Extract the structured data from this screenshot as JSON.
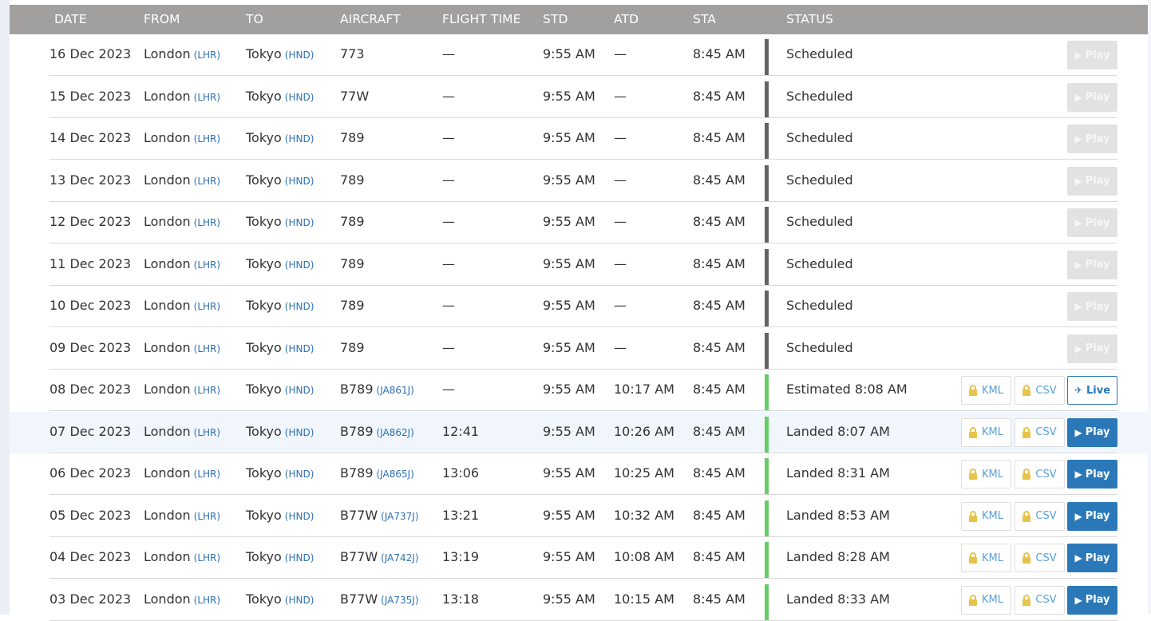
{
  "headers": {
    "date": "DATE",
    "from": "FROM",
    "to": "TO",
    "aircraft": "AIRCRAFT",
    "flight_time": "FLIGHT TIME",
    "std": "STD",
    "atd": "ATD",
    "sta": "STA",
    "status": "STATUS"
  },
  "buttons": {
    "play": "Play",
    "live": "Live",
    "kml": "KML",
    "csv": "CSV"
  },
  "colors": {
    "header_bg": "#a29f9f",
    "accent_blue": "#2b78b9",
    "status_scheduled": "#636363",
    "status_flown": "#66cc66",
    "row_highlight": "#f0f6fc"
  },
  "icons": {
    "play": "play-icon",
    "live": "airplane-icon",
    "locked": "lock-icon"
  },
  "rows": [
    {
      "date": "16 Dec 2023",
      "from": "London",
      "from_code": "(LHR)",
      "to": "Tokyo",
      "to_code": "(HND)",
      "aircraft": "773",
      "reg": "",
      "flight_time": "—",
      "std": "9:55 AM",
      "atd": "—",
      "sta": "8:45 AM",
      "status": "Scheduled",
      "state": "scheduled"
    },
    {
      "date": "15 Dec 2023",
      "from": "London",
      "from_code": "(LHR)",
      "to": "Tokyo",
      "to_code": "(HND)",
      "aircraft": "77W",
      "reg": "",
      "flight_time": "—",
      "std": "9:55 AM",
      "atd": "—",
      "sta": "8:45 AM",
      "status": "Scheduled",
      "state": "scheduled"
    },
    {
      "date": "14 Dec 2023",
      "from": "London",
      "from_code": "(LHR)",
      "to": "Tokyo",
      "to_code": "(HND)",
      "aircraft": "789",
      "reg": "",
      "flight_time": "—",
      "std": "9:55 AM",
      "atd": "—",
      "sta": "8:45 AM",
      "status": "Scheduled",
      "state": "scheduled"
    },
    {
      "date": "13 Dec 2023",
      "from": "London",
      "from_code": "(LHR)",
      "to": "Tokyo",
      "to_code": "(HND)",
      "aircraft": "789",
      "reg": "",
      "flight_time": "—",
      "std": "9:55 AM",
      "atd": "—",
      "sta": "8:45 AM",
      "status": "Scheduled",
      "state": "scheduled"
    },
    {
      "date": "12 Dec 2023",
      "from": "London",
      "from_code": "(LHR)",
      "to": "Tokyo",
      "to_code": "(HND)",
      "aircraft": "789",
      "reg": "",
      "flight_time": "—",
      "std": "9:55 AM",
      "atd": "—",
      "sta": "8:45 AM",
      "status": "Scheduled",
      "state": "scheduled"
    },
    {
      "date": "11 Dec 2023",
      "from": "London",
      "from_code": "(LHR)",
      "to": "Tokyo",
      "to_code": "(HND)",
      "aircraft": "789",
      "reg": "",
      "flight_time": "—",
      "std": "9:55 AM",
      "atd": "—",
      "sta": "8:45 AM",
      "status": "Scheduled",
      "state": "scheduled"
    },
    {
      "date": "10 Dec 2023",
      "from": "London",
      "from_code": "(LHR)",
      "to": "Tokyo",
      "to_code": "(HND)",
      "aircraft": "789",
      "reg": "",
      "flight_time": "—",
      "std": "9:55 AM",
      "atd": "—",
      "sta": "8:45 AM",
      "status": "Scheduled",
      "state": "scheduled"
    },
    {
      "date": "09 Dec 2023",
      "from": "London",
      "from_code": "(LHR)",
      "to": "Tokyo",
      "to_code": "(HND)",
      "aircraft": "789",
      "reg": "",
      "flight_time": "—",
      "std": "9:55 AM",
      "atd": "—",
      "sta": "8:45 AM",
      "status": "Scheduled",
      "state": "scheduled"
    },
    {
      "date": "08 Dec 2023",
      "from": "London",
      "from_code": "(LHR)",
      "to": "Tokyo",
      "to_code": "(HND)",
      "aircraft": "B789",
      "reg": "(JA861J)",
      "flight_time": "—",
      "std": "9:55 AM",
      "atd": "10:17 AM",
      "sta": "8:45 AM",
      "status": "Estimated 8:08 AM",
      "state": "live"
    },
    {
      "date": "07 Dec 2023",
      "from": "London",
      "from_code": "(LHR)",
      "to": "Tokyo",
      "to_code": "(HND)",
      "aircraft": "B789",
      "reg": "(JA862J)",
      "flight_time": "12:41",
      "std": "9:55 AM",
      "atd": "10:26 AM",
      "sta": "8:45 AM",
      "status": "Landed 8:07 AM",
      "state": "landed",
      "highlight": true
    },
    {
      "date": "06 Dec 2023",
      "from": "London",
      "from_code": "(LHR)",
      "to": "Tokyo",
      "to_code": "(HND)",
      "aircraft": "B789",
      "reg": "(JA865J)",
      "flight_time": "13:06",
      "std": "9:55 AM",
      "atd": "10:25 AM",
      "sta": "8:45 AM",
      "status": "Landed 8:31 AM",
      "state": "landed"
    },
    {
      "date": "05 Dec 2023",
      "from": "London",
      "from_code": "(LHR)",
      "to": "Tokyo",
      "to_code": "(HND)",
      "aircraft": "B77W",
      "reg": "(JA737J)",
      "flight_time": "13:21",
      "std": "9:55 AM",
      "atd": "10:32 AM",
      "sta": "8:45 AM",
      "status": "Landed 8:53 AM",
      "state": "landed"
    },
    {
      "date": "04 Dec 2023",
      "from": "London",
      "from_code": "(LHR)",
      "to": "Tokyo",
      "to_code": "(HND)",
      "aircraft": "B77W",
      "reg": "(JA742J)",
      "flight_time": "13:19",
      "std": "9:55 AM",
      "atd": "10:08 AM",
      "sta": "8:45 AM",
      "status": "Landed 8:28 AM",
      "state": "landed"
    },
    {
      "date": "03 Dec 2023",
      "from": "London",
      "from_code": "(LHR)",
      "to": "Tokyo",
      "to_code": "(HND)",
      "aircraft": "B77W",
      "reg": "(JA735J)",
      "flight_time": "13:18",
      "std": "9:55 AM",
      "atd": "10:15 AM",
      "sta": "8:45 AM",
      "status": "Landed 8:33 AM",
      "state": "landed"
    }
  ]
}
